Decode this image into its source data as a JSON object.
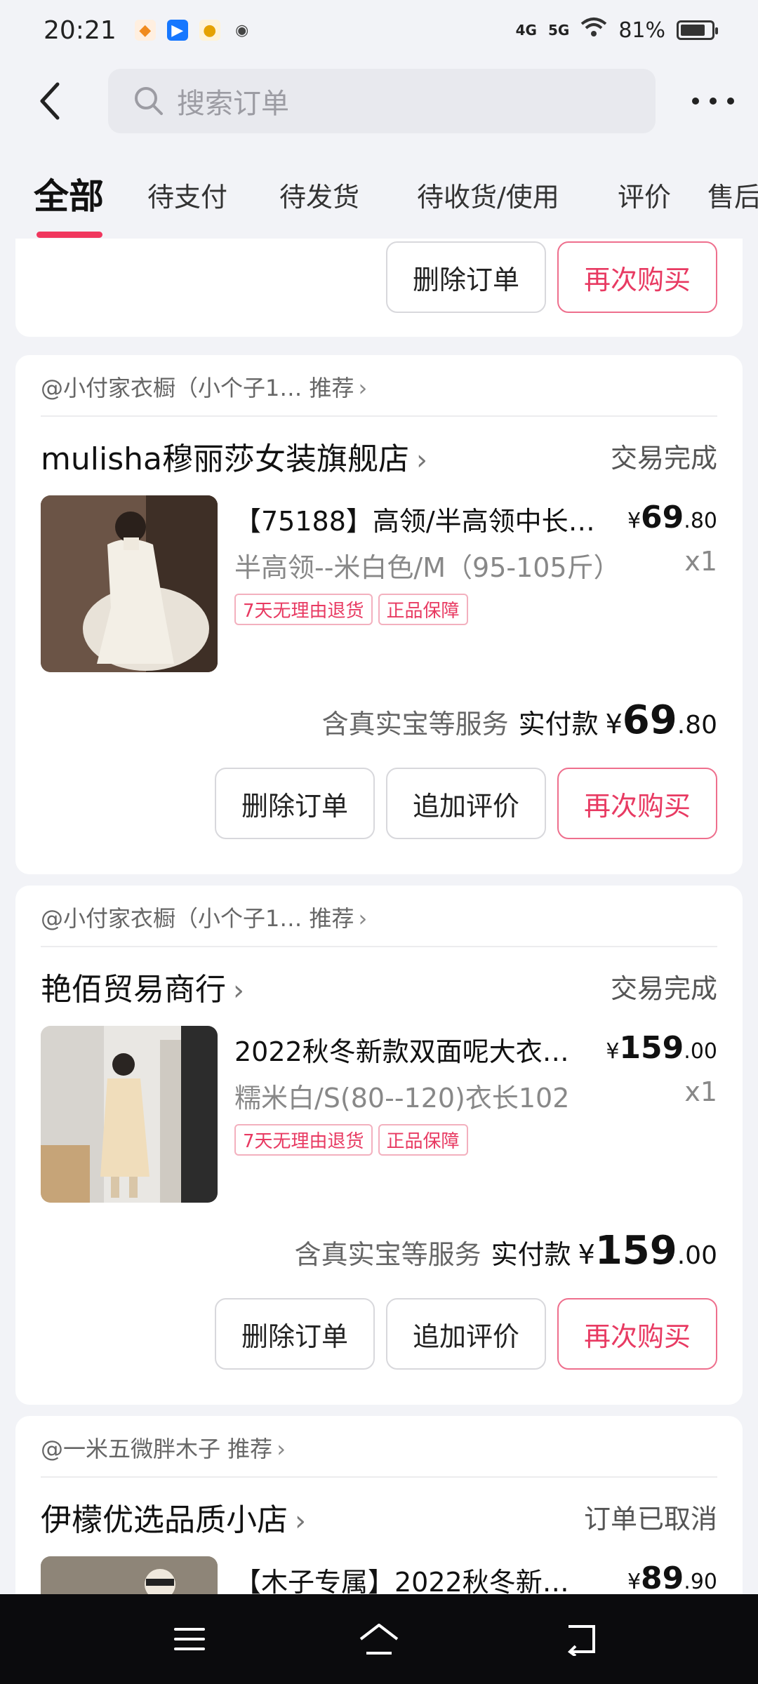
{
  "status_bar": {
    "time": "20:21",
    "signal1": "4G",
    "signal2": "5G",
    "battery": "81%"
  },
  "search": {
    "placeholder": "搜索订单"
  },
  "tabs": [
    {
      "label": "全部"
    },
    {
      "label": "待支付"
    },
    {
      "label": "待发货"
    },
    {
      "label": "待收货/使用"
    },
    {
      "label": "评价"
    },
    {
      "label": "售后"
    }
  ],
  "prev_card": {
    "delete_label": "删除订单",
    "rebuy_label": "再次购买"
  },
  "orders": [
    {
      "recommend": "@小付家衣橱（小个子1… 推荐",
      "shop": "mulisha穆丽莎女装旗舰店",
      "status": "交易完成",
      "title": "【75188】高领/半高领中长…",
      "price_symbol": "¥",
      "price_int": "69",
      "price_dec": ".80",
      "sku": "半高领--米白色/M（95-105斤）",
      "qty": "x1",
      "tags": [
        "7天无理由退货",
        "正品保障"
      ],
      "service_note": "含真实宝等服务",
      "paid_label": "实付款",
      "paid_symbol": "¥",
      "paid_int": "69",
      "paid_dec": ".80",
      "buttons": [
        "删除订单",
        "追加评价",
        "再次购买"
      ]
    },
    {
      "recommend": "@小付家衣橱（小个子1… 推荐",
      "shop": "艳佰贸易商行",
      "status": "交易完成",
      "title": "2022秋冬新款双面呢大衣…",
      "price_symbol": "¥",
      "price_int": "159",
      "price_dec": ".00",
      "sku": "糯米白/S(80--120)衣长102",
      "qty": "x1",
      "tags": [
        "7天无理由退货",
        "正品保障"
      ],
      "service_note": "含真实宝等服务",
      "paid_label": "实付款",
      "paid_symbol": "¥",
      "paid_int": "159",
      "paid_dec": ".00",
      "buttons": [
        "删除订单",
        "追加评价",
        "再次购买"
      ]
    },
    {
      "recommend": "@一米五微胖木子 推荐",
      "shop": "伊檬优选品质小店",
      "status": "订单已取消",
      "title": "【木子专属】2022秋冬新…",
      "price_symbol": "¥",
      "price_int": "89",
      "price_dec": ".90"
    }
  ],
  "colors": {
    "accent": "#f0375e",
    "background": "#f2f3f7"
  },
  "icons": {
    "back": "back-arrow-icon",
    "search": "search-icon",
    "more": "more-dots-icon",
    "nav": [
      "menu-icon",
      "home-icon",
      "back-icon"
    ]
  }
}
